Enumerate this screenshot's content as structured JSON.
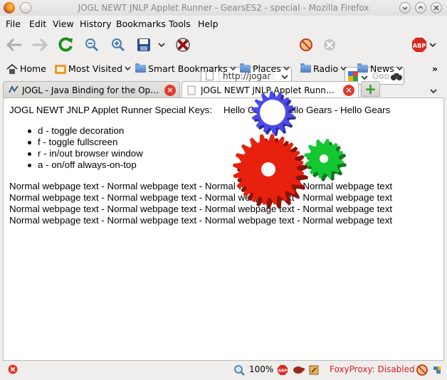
{
  "window": {
    "title": "JOGL NEWT JNLP Applet Runner - GearsES2 - special - Mozilla Firefox"
  },
  "menu": {
    "items": [
      "File",
      "Edit",
      "View",
      "History",
      "Bookmarks",
      "Tools",
      "Help"
    ]
  },
  "navigation": {
    "url": "http://jogar",
    "search_placeholder": "Goo"
  },
  "bookmarks": {
    "items": [
      "Home",
      "Most Visited",
      "Smart Bookmarks",
      "Places",
      "Radio",
      "News"
    ],
    "overflow": "»"
  },
  "tabs": [
    {
      "label": "JOGL - Java Binding for the Open..."
    },
    {
      "label": "JOGL NEWT JNLP Applet Runner ..."
    }
  ],
  "page": {
    "heading_text": "JOGL NEWT JNLP Applet Runner Special Keys:",
    "hello_text": "Hello Gears - Hello Gears - Hello Gears",
    "keys": [
      "d - toggle decoration",
      "f - toggle fullscreen",
      "r - in/out browser window",
      "a - on/off always-on-top"
    ],
    "body_lines": [
      "Normal webpage text - Normal webpage text - Normal webpage text - Normal webpage text",
      "Normal webpage text - Normal webpage text - Normal webpage text - Normal webpage text",
      "Normal webpage text - Normal webpage text - Normal webpage text - Normal webpage text",
      "Normal webpage text - Normal webpage text - Normal webpage text - Normal webpage text"
    ],
    "gear_colors": {
      "red": "#e8200e",
      "green": "#14c832",
      "blue": "#4a4aee"
    }
  },
  "status": {
    "zoom": "100%",
    "foxyproxy": "FoxyProxy: Disabled",
    "foxyproxy_color": "#d42020"
  },
  "icons": {
    "titlebar": [
      "firefox-icon",
      "minimize-icon",
      "maximize-icon",
      "close-icon"
    ],
    "toolbar": [
      "back-icon",
      "forward-icon",
      "reload-icon",
      "zoom-out-icon",
      "zoom-in-icon",
      "save-icon",
      "stop-icon",
      "blocked-icon",
      "cancel-icon",
      "adblock-icon"
    ]
  }
}
